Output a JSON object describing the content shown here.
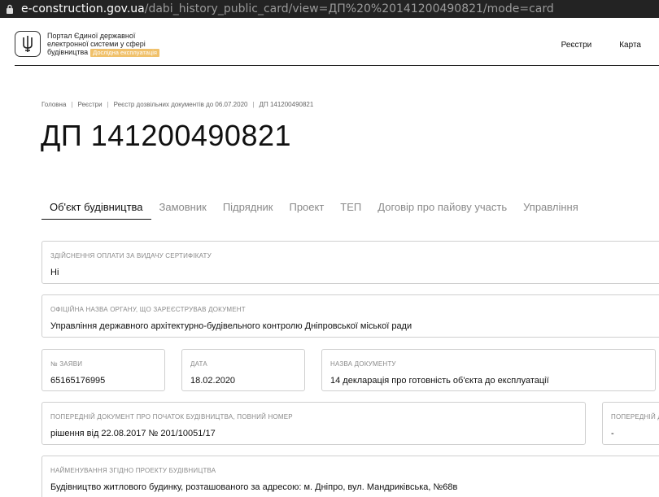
{
  "browser": {
    "url_domain": "e-construction.gov.ua",
    "url_path": "/dabi_history_public_card/view=ДП%20%20141200490821/mode=card"
  },
  "header": {
    "portal_line1": "Портал Єдиної державної",
    "portal_line2": "електронної системи у сфері",
    "portal_line3": "будівництва",
    "badge": "Дослідна експлуатація",
    "nav": {
      "registries": "Реєстри",
      "map": "Карта"
    }
  },
  "breadcrumb": {
    "home": "Головна",
    "registries": "Реєстри",
    "registry": "Реєстр дозвільних документів до 06.07.2020",
    "current": "ДП 141200490821"
  },
  "page_title": "ДП 141200490821",
  "tabs": [
    {
      "label": "Об'єкт будівництва"
    },
    {
      "label": "Замовник"
    },
    {
      "label": "Підрядник"
    },
    {
      "label": "Проект"
    },
    {
      "label": "ТЕП"
    },
    {
      "label": "Договір про пайову участь"
    },
    {
      "label": "Управління"
    }
  ],
  "fields": {
    "payment": {
      "label": "Здійснення оплати за видачу сертифікату",
      "value": "Ні"
    },
    "organ": {
      "label": "Офіційна назва органу, що зареєстрував документ",
      "value": "Управління державного архітектурно-будівельного контролю Дніпровської міської ради"
    },
    "application_no": {
      "label": "№ заяви",
      "value": "65165176995"
    },
    "date": {
      "label": "Дата",
      "value": "18.02.2020"
    },
    "doc_name": {
      "label": "Назва документу",
      "value": "14 декларація про готовність об'єкта до експлуатації"
    },
    "prev_doc": {
      "label": "Попередній документ про початок будівництва, повний номер",
      "value": "рішення від 22.08.2017 № 201/10051/17"
    },
    "prev_doc2": {
      "label": "Попередній д",
      "value": "-"
    },
    "project_name": {
      "label": "Найменування згідно проекту будівництва",
      "value": "Будівництво житлового будинку, розташованого за адресою: м. Дніпро, вул. Мандриківська, №68в"
    }
  }
}
